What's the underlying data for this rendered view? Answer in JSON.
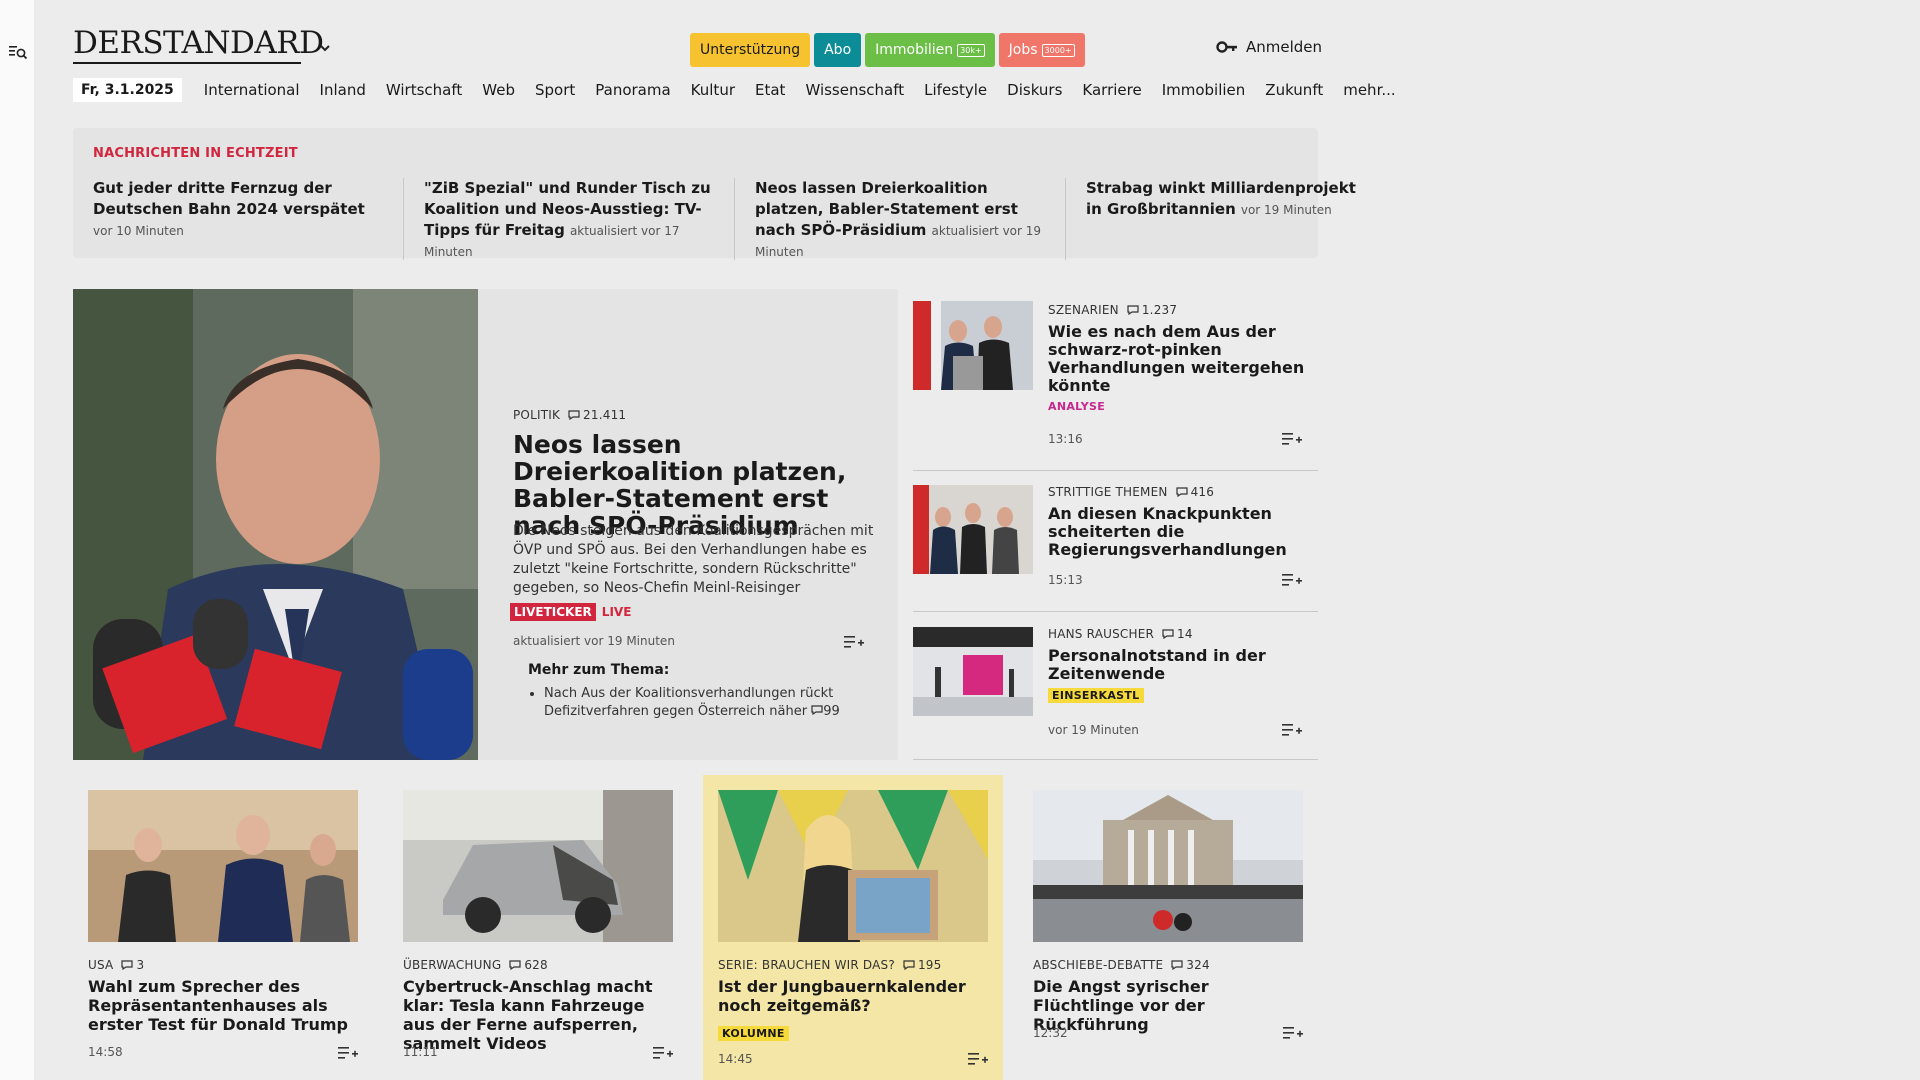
{
  "header": {
    "logo": "DERSTANDARD",
    "pills": [
      {
        "label": "Unterstützung",
        "tag": ""
      },
      {
        "label": "Abo",
        "tag": ""
      },
      {
        "label": "Immobilien",
        "tag": "30k+"
      },
      {
        "label": "Jobs",
        "tag": "3000+"
      }
    ],
    "login_label": "Anmelden"
  },
  "nav": {
    "date": "Fr, 3.1.2025",
    "items": [
      "International",
      "Inland",
      "Wirtschaft",
      "Web",
      "Sport",
      "Panorama",
      "Kultur",
      "Etat",
      "Wissenschaft",
      "Lifestyle",
      "Diskurs",
      "Karriere",
      "Immobilien",
      "Zukunft",
      "mehr..."
    ]
  },
  "ticker": {
    "heading": "NACHRICHTEN IN ECHTZEIT",
    "items": [
      {
        "title": "Gut jeder dritte Fernzug der Deutschen Bahn 2024 verspätet",
        "time": "vor 10 Minuten"
      },
      {
        "title": "\"ZiB Spezial\" und Runder Tisch zu Koalition und Neos-Ausstieg: TV-Tipps für Freitag",
        "time": "aktualisiert vor 17 Minuten"
      },
      {
        "title": "Neos lassen Dreierkoalition platzen, Babler-Statement erst nach SPÖ-Präsidium",
        "time": "aktualisiert vor 19 Minuten"
      },
      {
        "title": "Strabag winkt Milliardenprojekt in Großbritannien",
        "time": "vor 19 Minuten"
      }
    ]
  },
  "lead": {
    "category": "POLITIK",
    "comments": "21.411",
    "title": "Neos lassen Dreierkoalition platzen, Babler-Statement erst nach SPÖ-Präsidium",
    "teaser": "Die Neos steigen aus den Koalitionsgesprächen mit ÖVP und SPÖ aus. Bei den Verhandlungen habe es zuletzt \"keine Fortschritte, sondern Rückschritte\" gegeben, so Neos-Chefin Meinl-Reisinger",
    "badge": "LIVETICKER",
    "live": "LIVE",
    "time": "aktualisiert vor 19 Minuten",
    "more_heading": "Mehr zum Thema:",
    "more_item": "Nach Aus der Koalitionsverhandlungen rückt Defizitverfahren gegen Österreich näher",
    "more_comments": "99"
  },
  "side": [
    {
      "category": "SZENARIEN",
      "comments": "1.237",
      "title": "Wie es nach dem Aus der schwarz-rot-pinken Verhandlungen weitergehen könnte",
      "kicker": "ANALYSE",
      "time": "13:16"
    },
    {
      "category": "STRITTIGE THEMEN",
      "comments": "416",
      "title": "An diesen Knackpunkten scheiterten die Regierungsverhandlungen",
      "kicker": "",
      "time": "15:13"
    },
    {
      "category": "HANS RAUSCHER",
      "comments": "14",
      "title": "Personalnotstand in der Zeitenwende",
      "kicker": "EINSERKASTL",
      "time": "vor 19 Minuten"
    }
  ],
  "cards": [
    {
      "category": "USA",
      "comments": "3",
      "title": "Wahl zum Sprecher des Repräsentantenhauses als erster Test für Donald Trump",
      "kicker": "",
      "time": "14:58"
    },
    {
      "category": "ÜBERWACHUNG",
      "comments": "628",
      "title": "Cybertruck-Anschlag macht klar: Tesla kann Fahrzeuge aus der Ferne aufsperren, sammelt Videos",
      "kicker": "",
      "time": "11:11"
    },
    {
      "category": "SERIE: BRAUCHEN WIR DAS?",
      "comments": "195",
      "title": "Ist der Jungbauernkalender noch zeitgemäß?",
      "kicker": "KOLUMNE",
      "time": "14:45"
    },
    {
      "category": "ABSCHIEBE-DEBATTE",
      "comments": "324",
      "title": "Die Angst syrischer Flüchtlinge vor der Rückführung",
      "kicker": "",
      "time": "12:32"
    }
  ],
  "colors": {
    "accent_red": "#d1263e",
    "pink": "#c8278f",
    "yellow": "#f6c230",
    "teal": "#0c8c96",
    "green": "#6bbf46",
    "coral": "#ef7669"
  }
}
